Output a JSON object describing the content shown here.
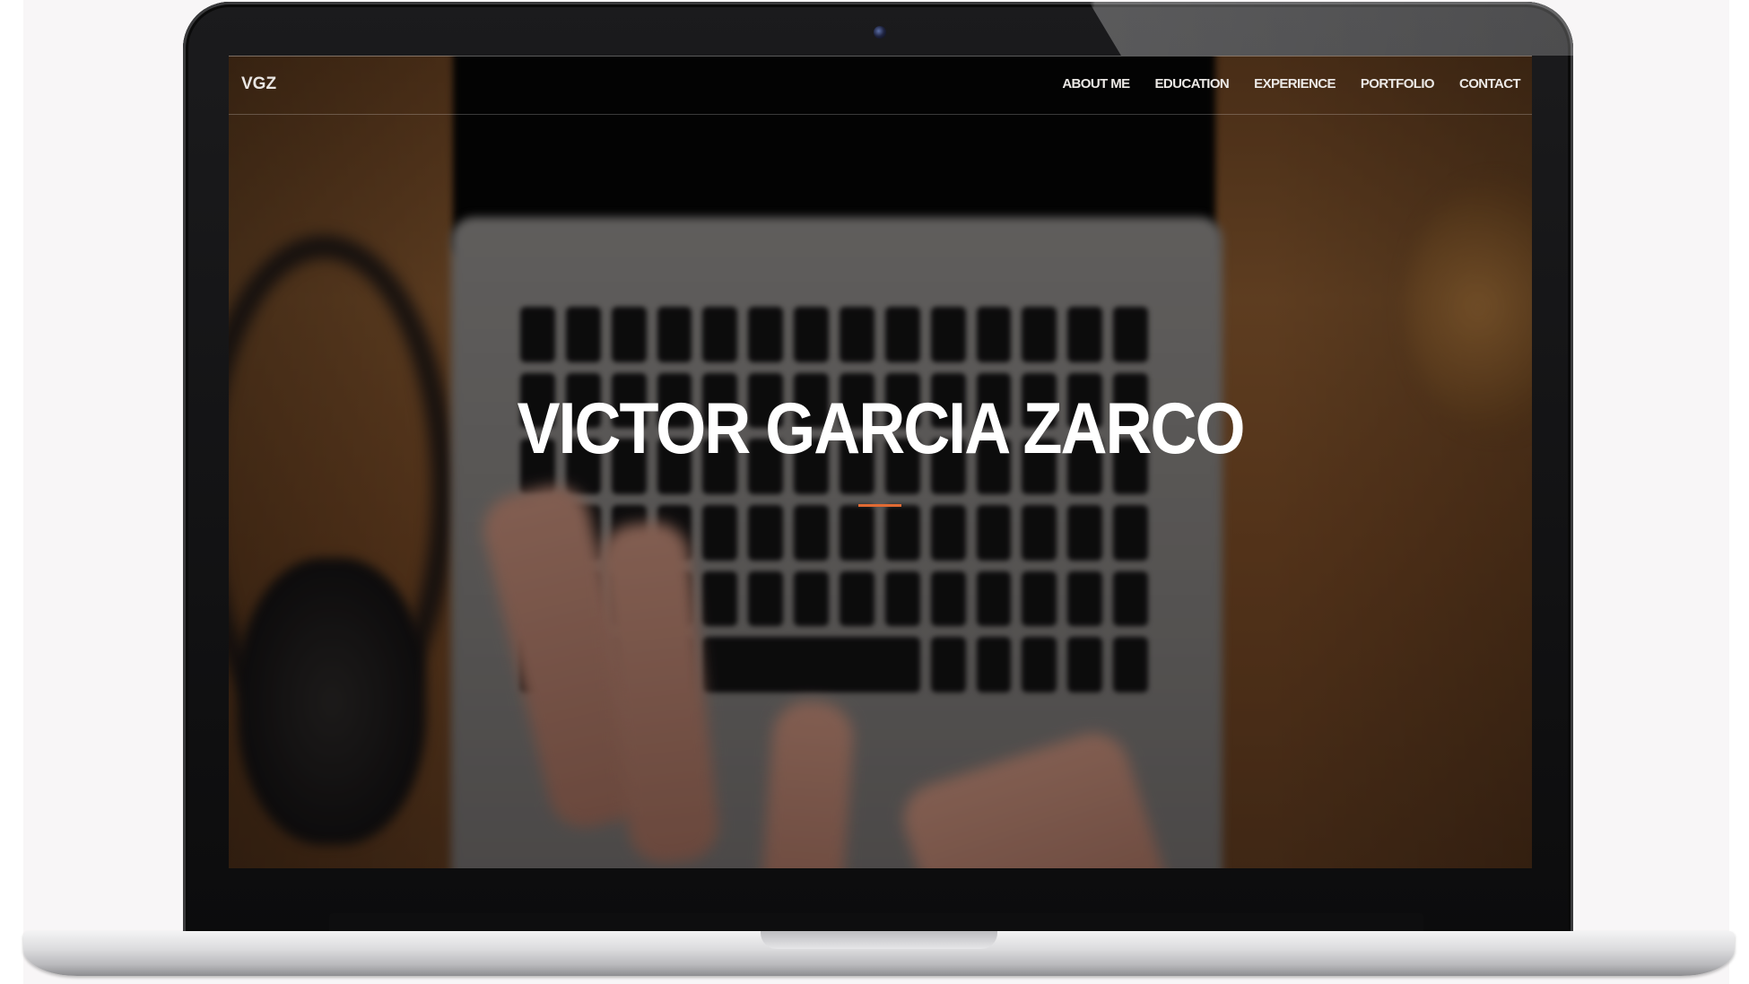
{
  "device": {
    "type": "laptop-mockup",
    "camera_icon": "webcam-icon"
  },
  "site": {
    "brand": "VGZ",
    "nav": [
      {
        "label": "ABOUT ME"
      },
      {
        "label": "EDUCATION"
      },
      {
        "label": "EXPERIENCE"
      },
      {
        "label": "PORTFOLIO"
      },
      {
        "label": "CONTACT"
      }
    ],
    "hero": {
      "title": "VICTOR GARCIA ZARCO",
      "accent_color": "#e06a33",
      "background": "blurred photo of hands typing on a laptop on a wooden desk"
    }
  }
}
